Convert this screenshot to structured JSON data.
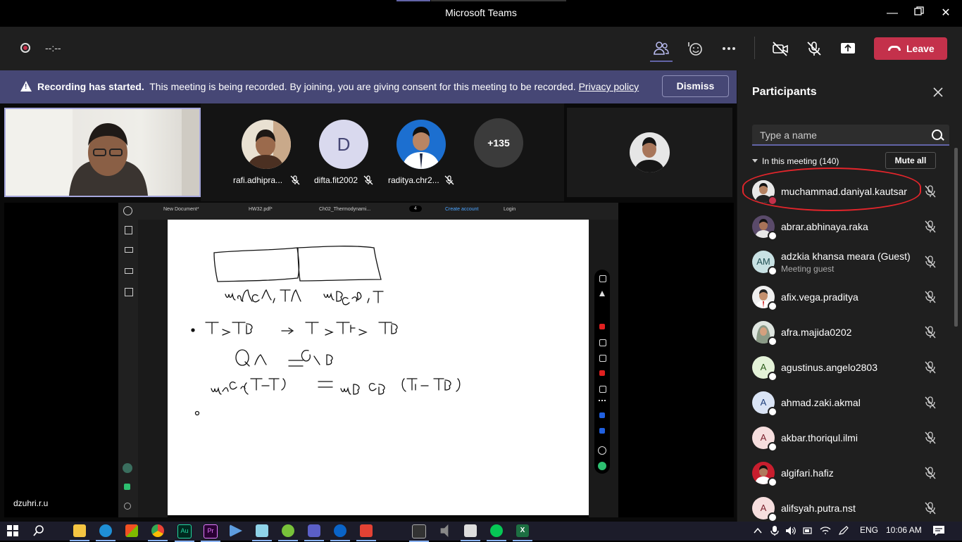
{
  "window": {
    "title": "Microsoft Teams"
  },
  "toolbar": {
    "timer": "--:--",
    "leave_label": "Leave"
  },
  "banner": {
    "bold": "Recording has started.",
    "text": "This meeting is being recorded. By joining, you are giving consent for this meeting to be recorded.",
    "link": "Privacy policy",
    "dismiss_label": "Dismiss"
  },
  "stage": {
    "strip": [
      {
        "name": "rafi.adhipra..."
      },
      {
        "name": "difta.fit2002",
        "initial": "D"
      },
      {
        "name": "raditya.chr2..."
      },
      {
        "more": "+135"
      }
    ],
    "presenter_name": "dzuhri.r.u",
    "share": {
      "tabs": [
        "New Document*",
        "HW32.pdf*",
        "Ch02_Thermodynami..."
      ],
      "create_account": "Create account",
      "login": "Login",
      "page": "4"
    }
  },
  "participants": {
    "title": "Participants",
    "search_placeholder": "Type a name",
    "in_meeting": "In this meeting (140)",
    "mute_all": "Mute all",
    "people": [
      {
        "name": "muchammad.daniyal.kautsar",
        "status": "red"
      },
      {
        "name": "abrar.abhinaya.raka"
      },
      {
        "name": "adzkia khansa meara (Guest)",
        "sub": "Meeting guest",
        "initials": "AM"
      },
      {
        "name": "afix.vega.praditya"
      },
      {
        "name": "afra.majida0202"
      },
      {
        "name": "agustinus.angelo2803",
        "initials": "A"
      },
      {
        "name": "ahmad.zaki.akmal",
        "initials": "A"
      },
      {
        "name": "akbar.thoriqul.ilmi",
        "initials": "A"
      },
      {
        "name": "algifari.hafiz"
      },
      {
        "name": "alifsyah.putra.nst",
        "initials": "A"
      }
    ]
  },
  "taskbar": {
    "language": "ENG",
    "time": "10:06 AM"
  },
  "colors": {
    "accent": "#6264a7",
    "leave": "#c4314b",
    "banner": "#464775",
    "highlight": "#e2252b"
  }
}
